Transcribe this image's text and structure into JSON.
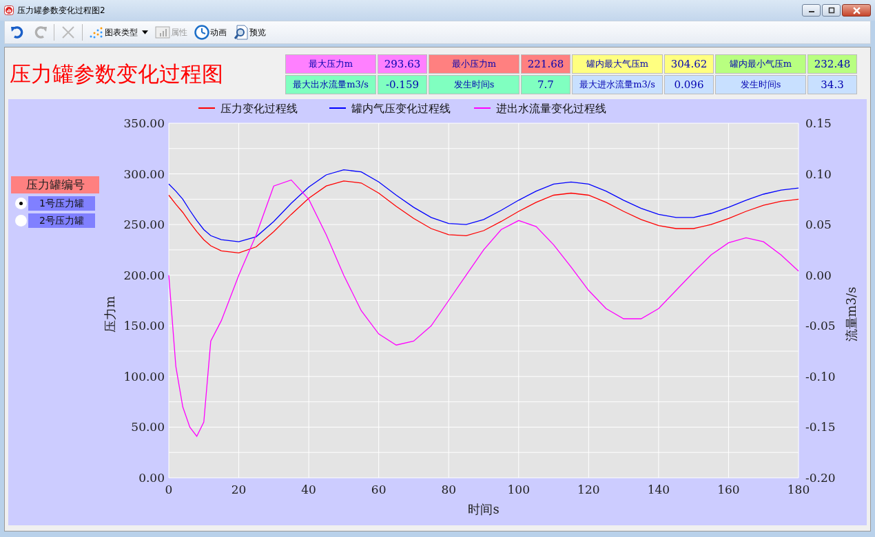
{
  "window": {
    "title": "压力罐参数变化过程图2"
  },
  "toolbar": [
    {
      "kind": "undo",
      "disabled": false
    },
    {
      "kind": "redo",
      "disabled": true
    },
    {
      "kind": "delete",
      "disabled": true
    },
    {
      "kind": "chart-type",
      "label": "图表类型",
      "disabled": false
    },
    {
      "kind": "properties",
      "label": "属性",
      "disabled": true
    },
    {
      "kind": "animation",
      "label": "动画",
      "disabled": false
    },
    {
      "kind": "preview",
      "label": "预览",
      "disabled": false
    }
  ],
  "heading": "压力罐参数变化过程图",
  "stats": [
    [
      {
        "label": "最大压力m",
        "value": "293.63",
        "color": "#ff80ff"
      },
      {
        "label": "最小压力m",
        "value": "221.68",
        "color": "#ff8080"
      },
      {
        "label": "罐内最大气压m",
        "value": "304.62",
        "color": "#ffff80"
      },
      {
        "label": "罐内最小气压m",
        "value": "232.48",
        "color": "#b8ff80"
      }
    ],
    [
      {
        "label": "最大出水流量m3/s",
        "value": "-0.159",
        "color": "#80ffc0"
      },
      {
        "label": "发生时间s",
        "value": "7.7",
        "color": "#80ffc0"
      },
      {
        "label": "最大进水流量m3/s",
        "value": "0.096",
        "color": "#c8e0ff"
      },
      {
        "label": "发生时间s",
        "value": "34.3",
        "color": "#c8e0ff"
      }
    ]
  ],
  "tank_selector": {
    "title": "压力罐编号",
    "options": [
      {
        "label": "1号压力罐",
        "selected": true
      },
      {
        "label": "2号压力罐",
        "selected": false
      }
    ]
  },
  "chart": {
    "chart_data": {
      "type": "line",
      "xlabel": "时间s",
      "ylabel": "压力m",
      "y2label": "流量m3/s",
      "x": [
        0,
        2,
        4,
        6,
        8,
        10,
        12,
        15,
        20,
        25,
        30,
        35,
        40,
        45,
        50,
        55,
        60,
        65,
        70,
        75,
        80,
        85,
        90,
        95,
        100,
        105,
        110,
        115,
        120,
        125,
        130,
        135,
        140,
        145,
        150,
        155,
        160,
        165,
        170,
        175,
        180
      ],
      "series": [
        {
          "name": "压力变化过程线",
          "color": "#ff0000",
          "values": [
            279,
            270,
            262,
            252,
            243,
            235,
            229,
            224,
            222,
            228,
            243,
            260,
            276,
            288,
            293,
            291,
            281,
            268,
            256,
            246,
            240,
            239,
            244,
            253,
            263,
            272,
            279,
            281,
            279,
            272,
            263,
            255,
            249,
            246,
            246,
            250,
            256,
            263,
            269,
            273,
            275
          ]
        },
        {
          "name": "罐内气压变化过程线",
          "color": "#0000ff",
          "values": [
            290,
            283,
            275,
            264,
            254,
            245,
            239,
            235,
            233,
            238,
            253,
            271,
            287,
            299,
            304,
            302,
            292,
            279,
            267,
            257,
            251,
            250,
            255,
            264,
            274,
            283,
            290,
            292,
            290,
            283,
            274,
            266,
            260,
            257,
            257,
            261,
            267,
            274,
            280,
            284,
            286
          ]
        },
        {
          "name": "进出水流量变化过程线",
          "color": "#ff00ff",
          "axis": "y2",
          "values": [
            0.0,
            -0.09,
            -0.13,
            -0.15,
            -0.159,
            -0.145,
            -0.065,
            -0.045,
            0.0,
            0.04,
            0.088,
            0.094,
            0.075,
            0.04,
            0.0,
            -0.035,
            -0.058,
            -0.069,
            -0.065,
            -0.05,
            -0.025,
            0.0,
            0.025,
            0.045,
            0.054,
            0.048,
            0.03,
            0.008,
            -0.015,
            -0.033,
            -0.043,
            -0.043,
            -0.033,
            -0.015,
            0.003,
            0.02,
            0.032,
            0.037,
            0.033,
            0.02,
            0.004
          ]
        }
      ],
      "grid": true,
      "legend": "top",
      "xlim": [
        0,
        180
      ],
      "ylim": [
        0,
        350
      ],
      "y2lim": [
        -0.2,
        0.15
      ],
      "xticks": [
        0,
        20,
        40,
        60,
        80,
        100,
        120,
        140,
        160,
        180
      ],
      "yticks": [
        {
          "value": 0,
          "label": "0.00"
        },
        {
          "value": 50,
          "label": "50.00"
        },
        {
          "value": 100,
          "label": "100.00"
        },
        {
          "value": 150,
          "label": "150.00"
        },
        {
          "value": 200,
          "label": "200.00"
        },
        {
          "value": 250,
          "label": "250.00"
        },
        {
          "value": 300,
          "label": "300.00"
        },
        {
          "value": 350,
          "label": "350.00"
        }
      ],
      "y2ticks": [
        {
          "value": -0.2,
          "label": "-0.20"
        },
        {
          "value": -0.15,
          "label": "-0.15"
        },
        {
          "value": -0.1,
          "label": "-0.10"
        },
        {
          "value": -0.05,
          "label": "-0.05"
        },
        {
          "value": 0,
          "label": "0.00"
        },
        {
          "value": 0.05,
          "label": "0.05"
        },
        {
          "value": 0.1,
          "label": "0.10"
        },
        {
          "value": 0.15,
          "label": "0.15"
        }
      ]
    }
  }
}
